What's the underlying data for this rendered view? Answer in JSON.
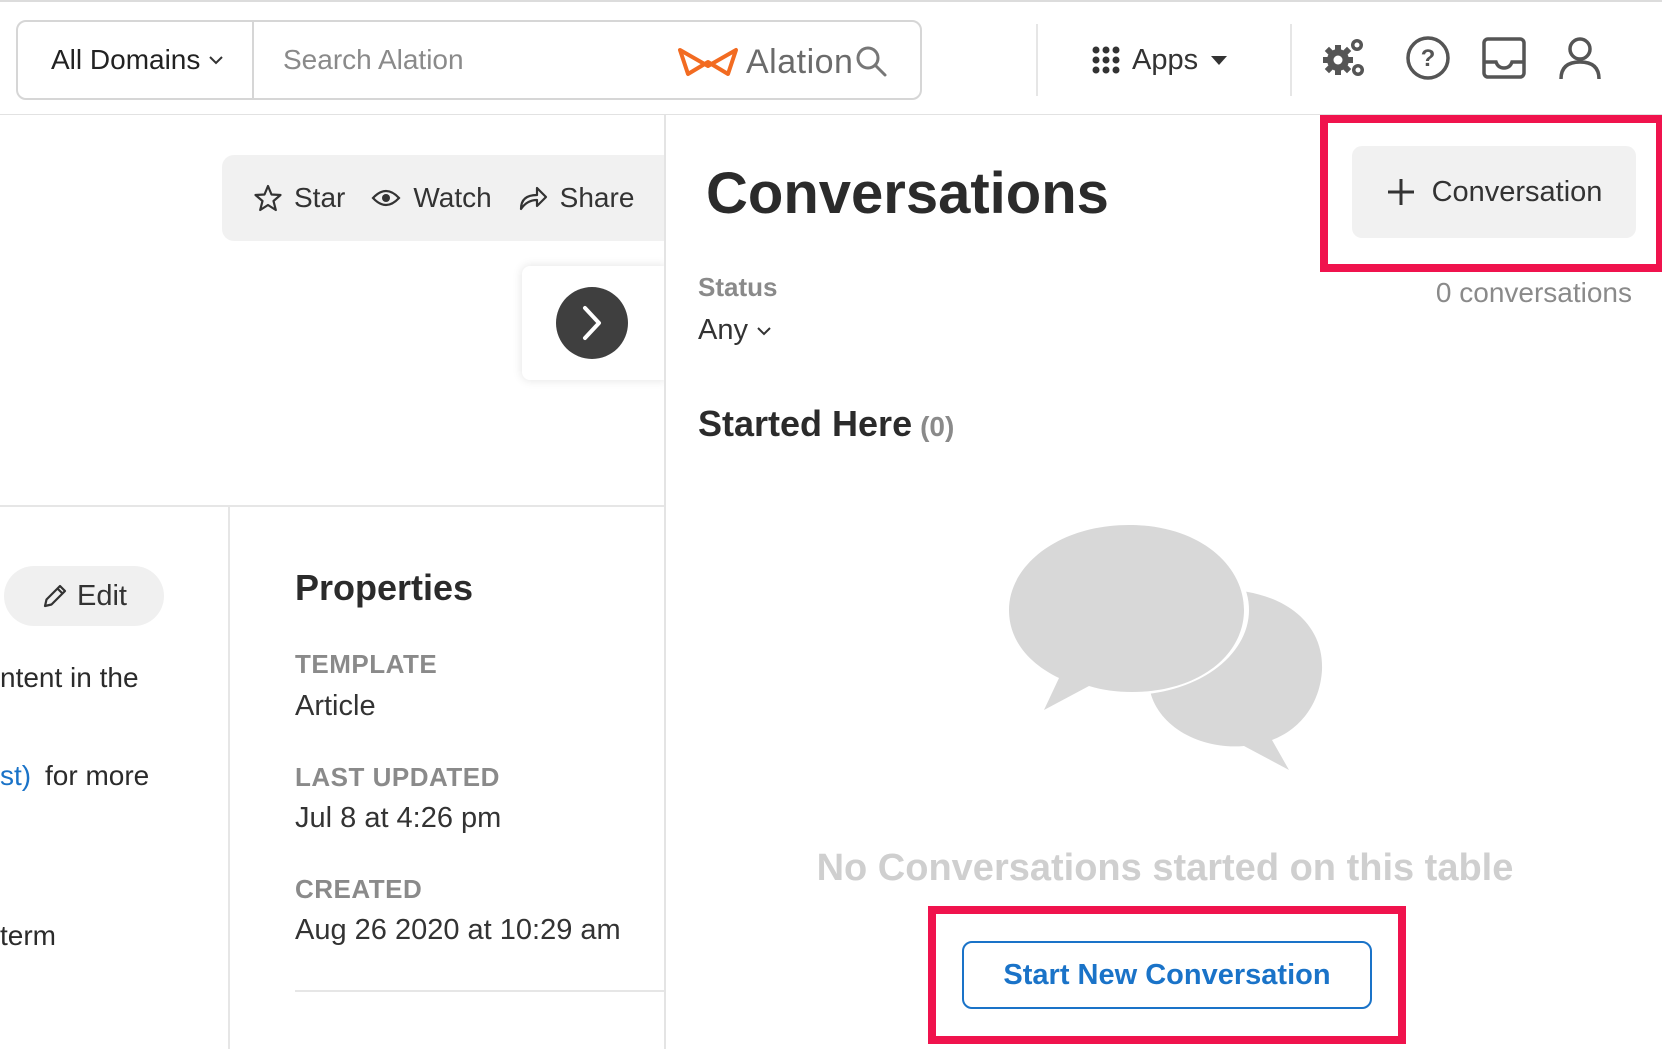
{
  "header": {
    "domains_label": "All Domains",
    "search_placeholder": "Search Alation",
    "brand_name": "Alation",
    "apps_label": "Apps",
    "icons": [
      "settings-gear-icon",
      "help-icon",
      "inbox-icon",
      "user-icon"
    ]
  },
  "actions": {
    "star_label": "Star",
    "watch_label": "Watch",
    "share_label": "Share"
  },
  "body": {
    "edit_label": "Edit",
    "fragments": [
      "ntent in the",
      "st)",
      "for more",
      "term"
    ]
  },
  "properties": {
    "title": "Properties",
    "items": [
      {
        "label": "TEMPLATE",
        "value": "Article"
      },
      {
        "label": "LAST UPDATED",
        "value": "Jul 8 at 4:26 pm"
      },
      {
        "label": "CREATED",
        "value": "Aug 26 2020 at 10:29 am"
      }
    ]
  },
  "conversations": {
    "title": "Conversations",
    "add_button_label": "Conversation",
    "status_label": "Status",
    "status_value": "Any",
    "count_text": "0 conversations",
    "started_here_label": "Started Here",
    "started_here_count": "(0)",
    "empty_message": "No Conversations started on this table",
    "start_button_label": "Start New Conversation"
  },
  "colors": {
    "highlight": "#f0134d",
    "link": "#1a73c8",
    "brand_orange": "#f26b21",
    "dark_button": "#3f3f3f"
  }
}
